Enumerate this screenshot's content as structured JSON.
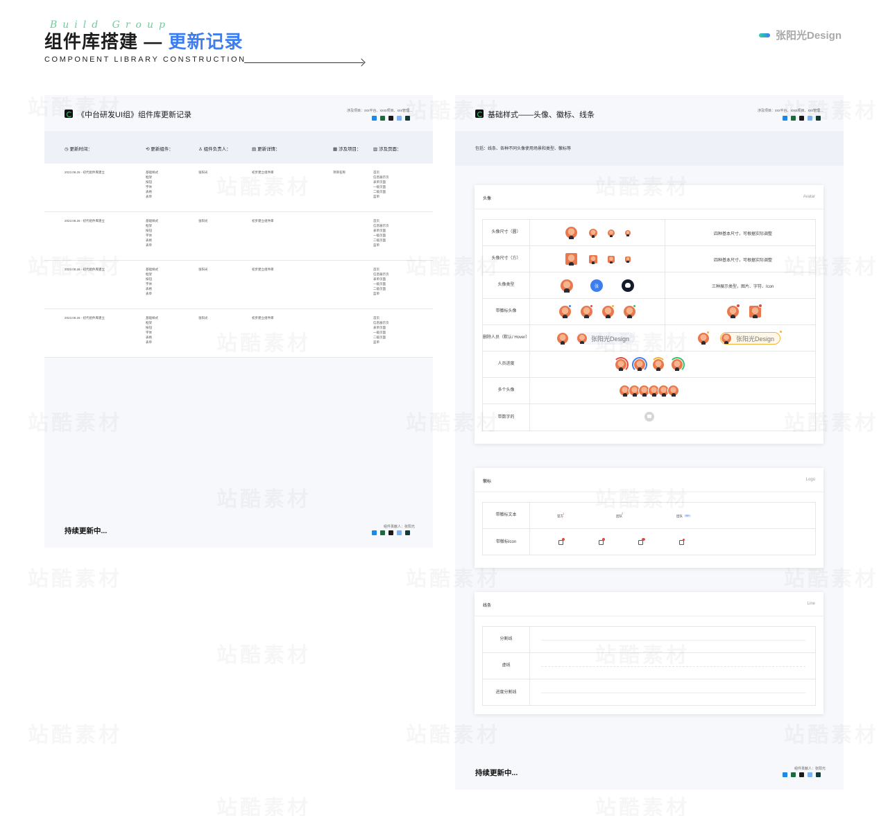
{
  "header": {
    "script_text": "Build Group",
    "title_main": "组件库搭建 — ",
    "title_highlight": "更新记录",
    "subtitle": "COMPONENT LIBRARY CONSTRUCTION",
    "brand": "张阳光Design",
    "accent": "#3c7ef0"
  },
  "left_panel": {
    "title": "《中台研发UI组》组件库更新记录",
    "meta": "涉及项目：xxx平台、xxxx项目、xxx管理...",
    "columns": [
      "更新时间：",
      "更新组件：",
      "组件负责人：",
      "更新详情：",
      "涉及项目：",
      "涉及页面："
    ],
    "rows": [
      {
        "time": "2023.08.26 - 初代组件库建立",
        "components": "基础样式\n框架\n按钮\n字体\n表格\n表单",
        "owner": "张阳光",
        "detail": "初步建立组件库",
        "project": "项目名称",
        "pages": "首页\n信息展示页\n表单页面\n一级页面\n二级页面\n蓝单"
      },
      {
        "time": "2023.08.26 - 初代组件库建立",
        "components": "基础样式\n框架\n按钮\n字体\n表格\n表单",
        "owner": "张阳光",
        "detail": "初步建立组件库",
        "project": "",
        "pages": "首页\n信息展示页\n表单页面\n一级页面\n二级页面\n蓝单"
      },
      {
        "time": "2023.08.26 - 初代组件库建立",
        "components": "基础样式\n框架\n按钮\n字体\n表格\n表单",
        "owner": "张阳光",
        "detail": "初步建立组件库",
        "project": "",
        "pages": "首页\n信息展示页\n表单页面\n一级页面\n二级页面\n蓝单"
      },
      {
        "time": "2023.08.26 - 初代组件库建立",
        "components": "基础样式\n框架\n按钮\n字体\n表格\n表单",
        "owner": "张阳光",
        "detail": "初步建立组件库",
        "project": "",
        "pages": "首页\n信息展示页\n表单页面\n一级页面\n二级页面\n蓝单"
      }
    ],
    "footer_text": "持续更新中...",
    "footer_meta": "组件贡献人：张阳光"
  },
  "right_panel": {
    "title": "基础样式——头像、徽标、线条",
    "meta": "涉及项目：xxx平台、xxxx项目、xxx管理...",
    "band": "包括：线条、各种不同头像使用场景和类型、徽标等",
    "avatar_card": {
      "title": "头像",
      "en": "Avatar",
      "rows": [
        "头像尺寸（圆）",
        "头像尺寸（方）",
        "头像类型",
        "带徽标头像",
        "删除人员（默认/\nHover）",
        "人员进度",
        "多个头像",
        "带数字的"
      ],
      "notes": [
        "四种基本尺寸，可根据实际调整",
        "四种基本尺寸，可根据实际调整",
        "三种展示类型，图片、字符、Icon"
      ],
      "text_avatar": "张",
      "chip_label": "张阳光Design"
    },
    "badge_card": {
      "title": "徽标",
      "en": "Logo",
      "rows": [
        "带徽标文本",
        "带徽标Icon"
      ],
      "texts": [
        "官方",
        "团队",
        "团队"
      ],
      "sup1": "1",
      "sup2": "2",
      "pill": "99+"
    },
    "line_card": {
      "title": "线条",
      "en": "Line",
      "rows": [
        "分割线",
        "虚线",
        "进度分割线"
      ]
    },
    "footer_text": "持续更新中...",
    "footer_meta": "组件贡献人：张阳光"
  },
  "watermark": "站酷素材"
}
